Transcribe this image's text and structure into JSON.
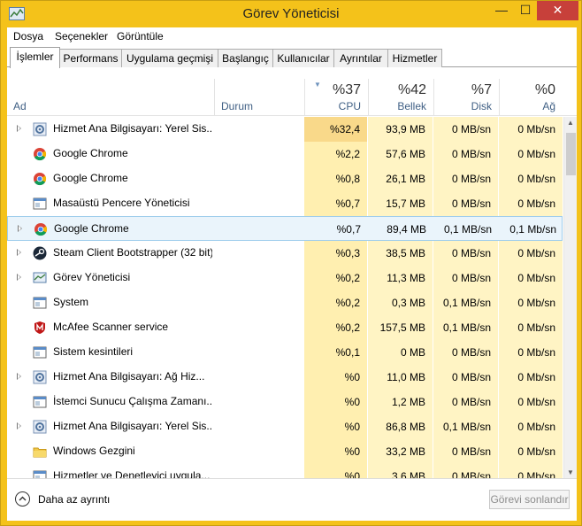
{
  "window": {
    "title": "Görev Yöneticisi",
    "min_glyph": "—",
    "max_glyph": "☐",
    "close_glyph": "✕"
  },
  "menu": [
    "Dosya",
    "Seçenekler",
    "Görüntüle"
  ],
  "tabs": [
    {
      "label": "İşlemler",
      "active": true
    },
    {
      "label": "Performans"
    },
    {
      "label": "Uygulama geçmişi"
    },
    {
      "label": "Başlangıç"
    },
    {
      "label": "Kullanıcılar"
    },
    {
      "label": "Ayrıntılar"
    },
    {
      "label": "Hizmetler"
    }
  ],
  "columns": {
    "name": "Ad",
    "status": "Durum",
    "cpu": {
      "pct": "%37",
      "label": "CPU"
    },
    "memory": {
      "pct": "%42",
      "label": "Bellek"
    },
    "disk": {
      "pct": "%7",
      "label": "Disk"
    },
    "network": {
      "pct": "%0",
      "label": "Ağ"
    }
  },
  "colors": {
    "cpu_high": "#f9d98a",
    "cell_light": "#fff4c4",
    "cell_mid": "#ffefb0",
    "selected_border": "#9fcdec",
    "titlebar": "#f4c21a",
    "close": "#c7403a"
  },
  "rows": [
    {
      "name": "Hizmet Ana Bilgisayarı: Yerel Sis...",
      "icon": "gear-icon",
      "expand": true,
      "cpu": "%32,4",
      "mem": "93,9 MB",
      "disk": "0 MB/sn",
      "net": "0 Mb/sn",
      "cpu_level": "high"
    },
    {
      "name": "Google Chrome",
      "icon": "chrome-icon",
      "expand": false,
      "cpu": "%2,2",
      "mem": "57,6 MB",
      "disk": "0 MB/sn",
      "net": "0 Mb/sn"
    },
    {
      "name": "Google Chrome",
      "icon": "chrome-icon",
      "expand": false,
      "cpu": "%0,8",
      "mem": "26,1 MB",
      "disk": "0 MB/sn",
      "net": "0 Mb/sn"
    },
    {
      "name": "Masaüstü Pencere Yöneticisi",
      "icon": "window-app-icon",
      "expand": false,
      "cpu": "%0,7",
      "mem": "15,7 MB",
      "disk": "0 MB/sn",
      "net": "0 Mb/sn"
    },
    {
      "name": "Google Chrome",
      "icon": "chrome-icon",
      "expand": true,
      "cpu": "%0,7",
      "mem": "89,4 MB",
      "disk": "0,1 MB/sn",
      "net": "0,1 Mb/sn",
      "selected": true
    },
    {
      "name": "Steam Client Bootstrapper (32 bit)",
      "icon": "steam-icon",
      "expand": true,
      "cpu": "%0,3",
      "mem": "38,5 MB",
      "disk": "0 MB/sn",
      "net": "0 Mb/sn"
    },
    {
      "name": "Görev Yöneticisi",
      "icon": "task-manager-icon",
      "expand": true,
      "cpu": "%0,2",
      "mem": "11,3 MB",
      "disk": "0 MB/sn",
      "net": "0 Mb/sn"
    },
    {
      "name": "System",
      "icon": "window-app-icon",
      "expand": false,
      "cpu": "%0,2",
      "mem": "0,3 MB",
      "disk": "0,1 MB/sn",
      "net": "0 Mb/sn"
    },
    {
      "name": "McAfee Scanner service",
      "icon": "mcafee-icon",
      "expand": false,
      "cpu": "%0,2",
      "mem": "157,5 MB",
      "disk": "0,1 MB/sn",
      "net": "0 Mb/sn"
    },
    {
      "name": "Sistem kesintileri",
      "icon": "window-app-icon",
      "expand": false,
      "cpu": "%0,1",
      "mem": "0 MB",
      "disk": "0 MB/sn",
      "net": "0 Mb/sn"
    },
    {
      "name": "Hizmet Ana Bilgisayarı: Ağ Hiz...",
      "icon": "gear-icon",
      "expand": true,
      "cpu": "%0",
      "mem": "11,0 MB",
      "disk": "0 MB/sn",
      "net": "0 Mb/sn"
    },
    {
      "name": "İstemci Sunucu Çalışma Zamanı...",
      "icon": "window-app-icon",
      "expand": false,
      "cpu": "%0",
      "mem": "1,2 MB",
      "disk": "0 MB/sn",
      "net": "0 Mb/sn"
    },
    {
      "name": "Hizmet Ana Bilgisayarı: Yerel Sis...",
      "icon": "gear-icon",
      "expand": true,
      "cpu": "%0",
      "mem": "86,8 MB",
      "disk": "0,1 MB/sn",
      "net": "0 Mb/sn"
    },
    {
      "name": "Windows Gezgini",
      "icon": "folder-icon",
      "expand": false,
      "cpu": "%0",
      "mem": "33,2 MB",
      "disk": "0 MB/sn",
      "net": "0 Mb/sn"
    },
    {
      "name": "Hizmetler ve Denetleyici uygula...",
      "icon": "window-app-icon",
      "expand": false,
      "cpu": "%0",
      "mem": "3,6 MB",
      "disk": "0 MB/sn",
      "net": "0 Mb/sn"
    }
  ],
  "footer": {
    "fewer_details": "Daha az ayrıntı",
    "end_task": "Görevi sonlandır"
  }
}
